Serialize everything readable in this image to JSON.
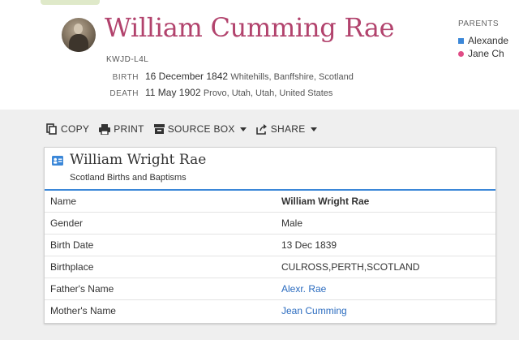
{
  "person": {
    "name": "William Cumming Rae",
    "pid": "KWJD-L4L",
    "birth": {
      "label": "BIRTH",
      "date": "16 December 1842",
      "place": "Whitehills, Banffshire, Scotland"
    },
    "death": {
      "label": "DEATH",
      "date": "11 May 1902",
      "place": "Provo, Utah, Utah, United States"
    }
  },
  "parents": {
    "label": "PARENTS",
    "father": "Alexande",
    "mother": "Jane Ch"
  },
  "toolbar": {
    "copy": "COPY",
    "print": "PRINT",
    "source_box": "SOURCE BOX",
    "share": "SHARE"
  },
  "record": {
    "title": "William Wright Rae",
    "collection": "Scotland Births and Baptisms",
    "rows": [
      {
        "label": "Name",
        "value": "William Wright Rae"
      },
      {
        "label": "Gender",
        "value": "Male"
      },
      {
        "label": "Birth Date",
        "value": "13 Dec 1839"
      },
      {
        "label": "Birthplace",
        "value": "CULROSS,PERTH,SCOTLAND"
      },
      {
        "label": "Father's Name",
        "value": "Alexr. Rae"
      },
      {
        "label": "Mother's Name",
        "value": "Jean Cumming"
      }
    ]
  },
  "colors": {
    "name": "#b2436d",
    "link": "#2a6bbf",
    "accent": "#3b87d8",
    "female": "#e04c86"
  },
  "icons": [
    "copy-icon",
    "print-icon",
    "source-box-icon",
    "share-icon",
    "record-card-icon"
  ]
}
